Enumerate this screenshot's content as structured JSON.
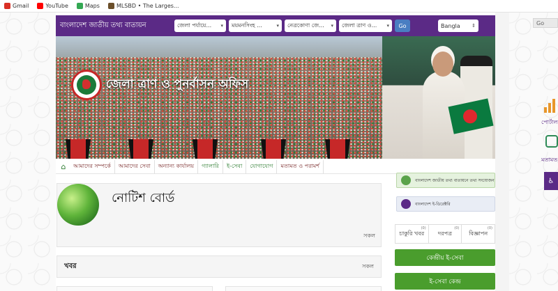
{
  "bookmarks": [
    {
      "label": "Gmail",
      "color": "#d93025"
    },
    {
      "label": "YouTube",
      "color": "#ff0000"
    },
    {
      "label": "Maps",
      "color": "#34a853"
    },
    {
      "label": "MLSBD • The Larges...",
      "color": "#6b4f2a"
    }
  ],
  "topbar": {
    "portal_title": "বাংলাদেশ জাতীয় তথ্য বাতায়ন",
    "selects": [
      "জেলা পর্যায়ে...",
      "ময়মনসিংহ ...",
      "নেত্রকোণা জে...",
      "জেলা ত্রাণ ও..."
    ],
    "go_label": "Go",
    "language": "Bangla"
  },
  "banner": {
    "office_name": "জেলা ত্রাণ ও পুনর্বাসন অফিস"
  },
  "nav": {
    "items": [
      "আমাদের সম্পর্কে",
      "আমাদের সেবা",
      "অন্যান্য কার্যালয়",
      "গ্যালারি",
      "ই-সেবা",
      "যোগাযোগ",
      "মতামত ও পরামর্শ"
    ]
  },
  "notice_board": {
    "title": "নোটিশ বোর্ড",
    "all_label": "সকল"
  },
  "news": {
    "title": "খবর",
    "all_label": "সকল"
  },
  "right_column": {
    "pill_1": "বাংলাদেশ জাতীয় তথ্য বাতায়নে তথ্য সংযোজন",
    "pill_2": "বাংলাদেশ ই-ডিরেক্টরি",
    "tabs": [
      {
        "label": "চাকুরি খবর",
        "count": "(0)"
      },
      {
        "label": "দরপত্র",
        "count": "(0)"
      },
      {
        "label": "বিজ্ঞাপন",
        "count": "(0)"
      }
    ],
    "green_buttons": [
      "কেন্দ্রীয় ই-সেবা",
      "ই-সেবা কেন্দ্র"
    ]
  },
  "widgets": {
    "chart_label": "পোর্টাল",
    "chat_label": "মতামত",
    "scroll_label": "Go"
  },
  "colors": {
    "topbar": "#5b2a86",
    "green": "#4a9d2d",
    "nav_text": "#7b2d2d"
  }
}
